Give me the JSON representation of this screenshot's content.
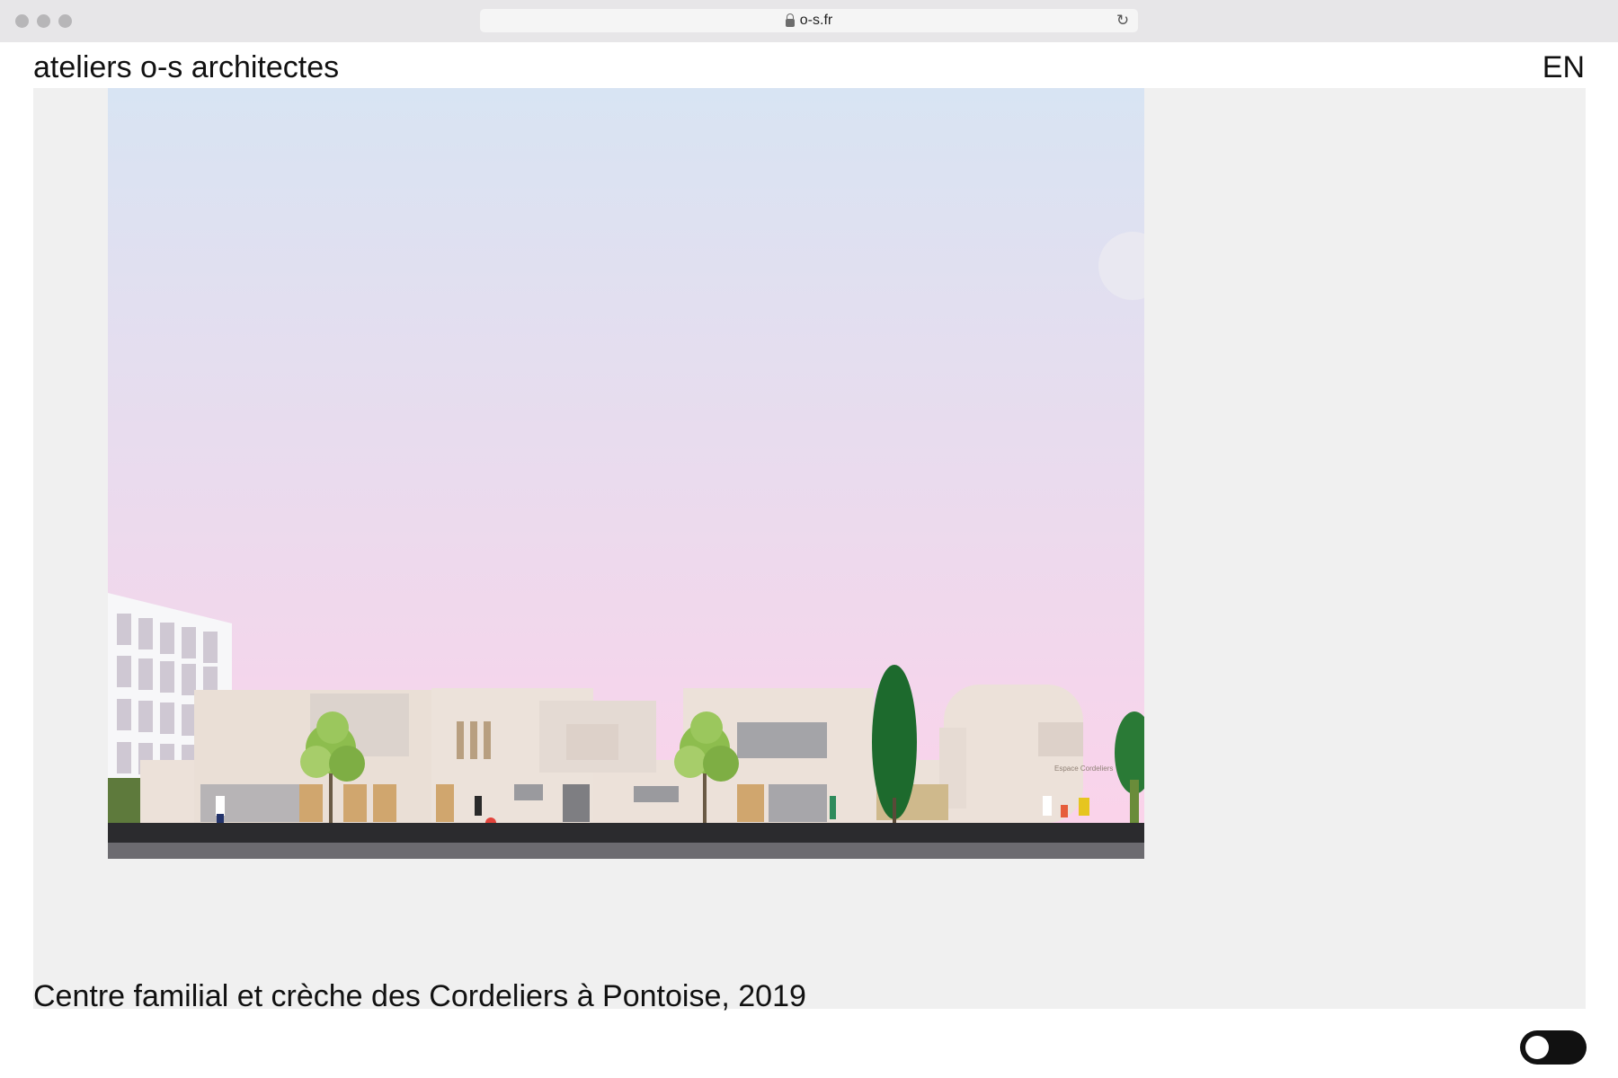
{
  "browser": {
    "url": "o-s.fr"
  },
  "header": {
    "site_title": "ateliers o-s architectes",
    "lang_link": "EN"
  },
  "project": {
    "caption": "Centre familial et crèche des Cordeliers à Pontoise, 2019",
    "sign_text": "Espace Cordeliers"
  },
  "colors": {
    "sky_top": "#d8e4f3",
    "sky_bottom": "#fcd2ea",
    "building": "#ece1d9",
    "road": "#2b2b2e",
    "toggle": "#111111"
  },
  "icons": {
    "lock": "lock-icon",
    "reload": "reload-icon",
    "toggle": "theme-toggle"
  }
}
